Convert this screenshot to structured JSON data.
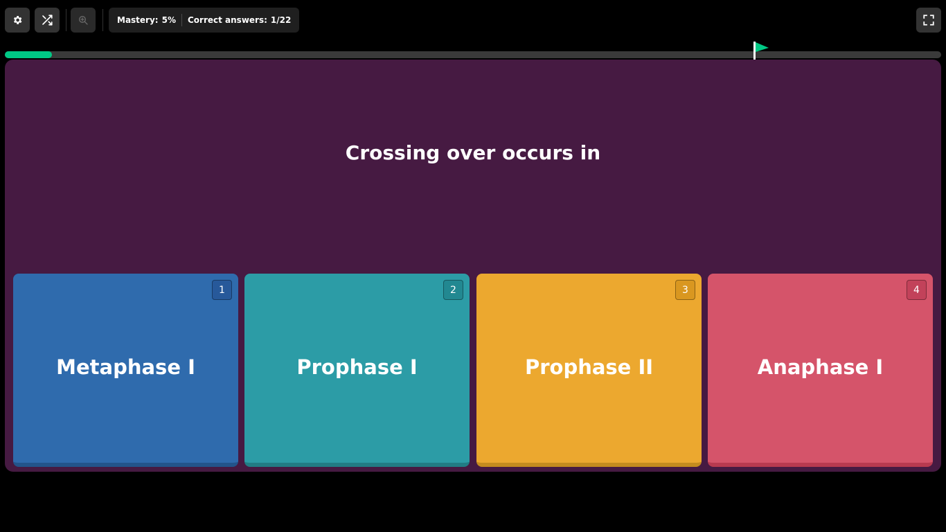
{
  "toolbar": {
    "settings_icon": "gear-icon",
    "shuffle_icon": "shuffle-icon",
    "zoom_icon": "zoom-in-icon",
    "fullscreen_icon": "fullscreen-icon",
    "mastery_label": "Mastery:",
    "mastery_value": "5%",
    "correct_label": "Correct answers:",
    "correct_value": "1/22"
  },
  "progress": {
    "fraction": 0.05,
    "flag_color": "#00c985",
    "fill_color": "#00c985"
  },
  "question": {
    "text": "Crossing over occurs in"
  },
  "options": [
    {
      "label": "Metaphase I",
      "key": "1",
      "color": "#2f6bad"
    },
    {
      "label": "Prophase I",
      "key": "2",
      "color": "#2c9ca6"
    },
    {
      "label": "Prophase II",
      "key": "3",
      "color": "#eca82f"
    },
    {
      "label": "Anaphase I",
      "key": "4",
      "color": "#d5546a"
    }
  ],
  "colors": {
    "background": "#000000",
    "card": "#461a42"
  }
}
